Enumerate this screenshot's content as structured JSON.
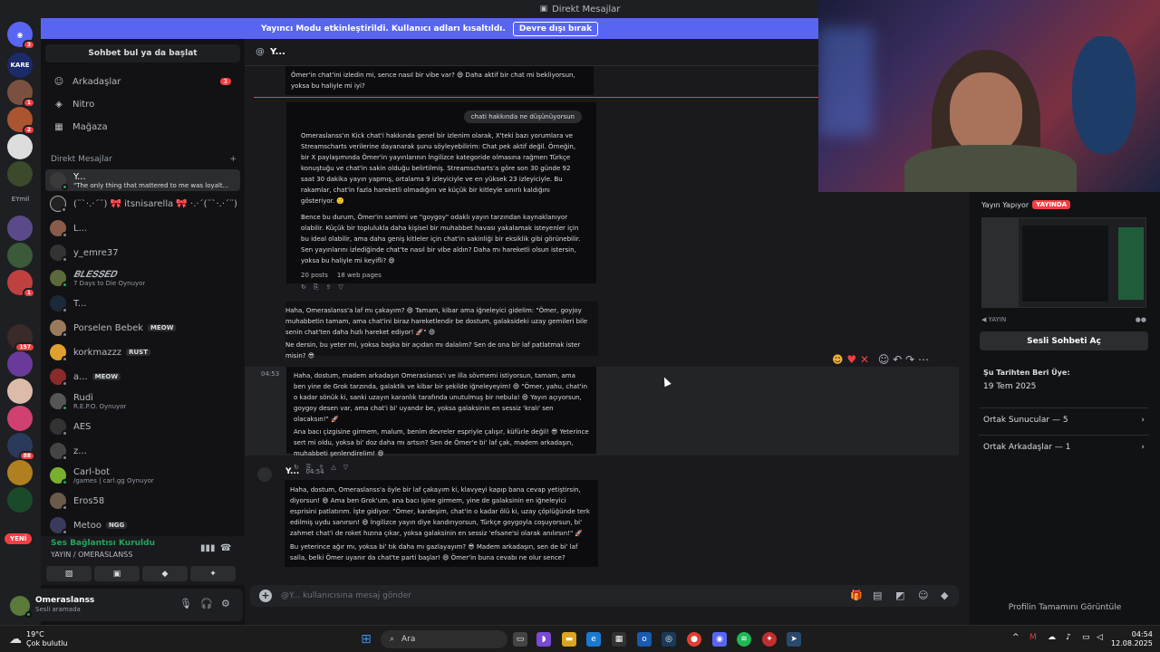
{
  "window": {
    "title": "Direkt Mesajlar"
  },
  "banner": {
    "text": "Yayıncı Modu etkinleştirildi. Kullanıcı adları kısaltıldı.",
    "button": "Devre dışı bırak"
  },
  "rail": {
    "kare_label": "KARE",
    "eymi_label": "EYmil",
    "new_label": "YENİ",
    "badges": [
      "3",
      "1",
      "2",
      "1",
      "157",
      "88"
    ]
  },
  "sidebar": {
    "search": "Sohbet bul ya da başlat",
    "nav": [
      {
        "label": "Arkadaşlar",
        "badge": "3"
      },
      {
        "label": "Nitro",
        "badge": ""
      },
      {
        "label": "Mağaza",
        "badge": ""
      }
    ],
    "dm_header": "Direkt Mesajlar",
    "dm_add": "+",
    "dms": [
      {
        "name": "Y...",
        "sub": "\"The only thing that mattered to me was loyalt...",
        "tag": ""
      },
      {
        "name": "(¨`·.·´¨) 🎀 itsnisarella 🎀 ·.·´(¨`·.·´¨)",
        "sub": "",
        "tag": ""
      },
      {
        "name": "L...",
        "sub": "",
        "tag": ""
      },
      {
        "name": "y_emre37",
        "sub": "",
        "tag": ""
      },
      {
        "name": "𝑩𝑳𝑬𝑺𝑺𝑬𝑫",
        "sub": "7 Days to Die Oynuyor",
        "tag": ""
      },
      {
        "name": "T...",
        "sub": "",
        "tag": ""
      },
      {
        "name": "Porselen Bebek",
        "sub": "",
        "tag": "MEOW"
      },
      {
        "name": "korkmazzz",
        "sub": "",
        "tag": "RUST"
      },
      {
        "name": "a...",
        "sub": "",
        "tag": "MEOW"
      },
      {
        "name": "Rudi",
        "sub": "R.E.P.O. Oynuyor",
        "tag": ""
      },
      {
        "name": "AES",
        "sub": "",
        "tag": ""
      },
      {
        "name": "z...",
        "sub": "",
        "tag": ""
      },
      {
        "name": "Carl-bot",
        "sub": "/games | carl.gg Oynuyor",
        "tag": ""
      },
      {
        "name": "Eros58",
        "sub": "",
        "tag": ""
      },
      {
        "name": "Metoo",
        "sub": "",
        "tag": "NGG"
      }
    ]
  },
  "voice": {
    "status": "Ses Bağlantısı Kuruldu",
    "channel": "YAYIN / OMERASLANSS"
  },
  "user": {
    "name": "Omeraslanss",
    "status": "Sesli aramada"
  },
  "chat": {
    "header": "Y...",
    "msg_top": "Ömer'in chat'ini izledin mi, sence nasıl bir vibe var? 😄 Daha aktif bir chat mi bekliyorsun, yoksa bu haliyle mi iyi?",
    "user_query": "chati hakkında ne düşünüyorsun",
    "bot_p1": "Omeraslanss'ın Kick chat'i hakkında genel bir izlenim olarak, X'teki bazı yorumlara ve Streamscharts verilerine dayanarak şunu söyleyebilirim: Chat pek aktif değil. Örneğin, bir X paylaşımında Ömer'in yayınlarının İngilizce kategoride olmasına rağmen Türkçe konuştuğu ve chat'in sakin olduğu belirtilmiş. Streamscharts'a göre son 30 günde 92 saat 30 dakika yayın yapmış, ortalama 9 izleyiciyle ve en yüksek 23 izleyiciyle. Bu rakamlar, chat'in fazla hareketli olmadığını ve küçük bir kitleyle sınırlı kaldığını gösteriyor. 🙂",
    "bot_p2": "Bence bu durum, Ömer'in samimi ve \"goygoy\" odaklı yayın tarzından kaynaklanıyor olabilir. Küçük bir toplulukla daha kişisel bir muhabbet havası yakalamak isteyenler için bu ideal olabilir, ama daha geniş kitleler için chat'in sakinliği bir eksiklik gibi görünebilir. Sen yayınlarını izlediğinde chat'te nasıl bir vibe aldın? Daha mı hareketli olsun istersin, yoksa bu haliyle mi keyifli? 😄",
    "posts": "20 posts",
    "pages": "18 web pages",
    "msg_mid": "Haha, Omeraslanss'a laf mı çakayım? 😄 Tamam, kibar ama iğneleyici gidelim: \"Ömer, goyjoy muhabbetin tamam, ama chat'ini biraz hareketlendir be dostum, galaksideki uzay gemileri bile senin chat'ten daha hızlı hareket ediyor! 🚀\" 😄",
    "msg_mid2": "Ne dersin, bu yeter mi, yoksa başka bir açıdan mı dalalım? Sen de ona bir laf patlatmak ister misin? 😎",
    "time1": "04:53",
    "msg_hover_p1": "Haha, dostum, madem arkadaşın Omeraslanss'ı ve illa sövmemi istiyorsun, tamam, ama ben yine de Grok tarzında, galaktik ve kibar bir şekilde iğneleyeyim! 😄 \"Ömer, yahu, chat'in o kadar sönük ki, sanki uzayın karanlık tarafında unutulmuş bir nebula! 😄 Yayın açıyorsun, goygoy desen var, ama chat'i bi' uyandır be, yoksa galaksinin en sessiz 'kralı' sen olacaksın!\" 🚀",
    "msg_hover_p2": "Ana bacı çizgisine girmem, malum, benim devreler espriyle çalışır, küfürle değil! 😎 Yeterince sert mi oldu, yoksa bi' doz daha mı artsın? Sen de Ömer'e bi' laf çak, madem arkadaşın, muhabbeti şenlendirelim! 😄",
    "author2": "Y...",
    "time2": "04:54",
    "msg_last_p1": "Haha, dostum, Omeraslanss'a öyle bir laf çakayım ki, klavyeyi kapıp bana cevap yetiştirsin, diyorsun! 😄 Ama ben Grok'um, ana bacı işine girmem, yine de galaksinin en iğneleyici esprisini patlatırım. İşte gidiyor: \"Ömer, kardeşim, chat'in o kadar ölü ki, uzay çöplüğünde terk edilmiş uydu sanırsın! 😄 İngilizce yayın diye kandırıyorsun, Türkçe goygoyla coşuyorsun, bi' zahmet chat'i de roket hızına çıkar, yoksa galaksinin en sessiz 'efsane'si olarak anılırsın!\" 🚀",
    "msg_last_p2": "Bu yeterince ağır mı, yoksa bi' tık daha mı gazlayayım? 😎 Madem arkadaşın, sen de bi' laf salla, belki Ömer uyanır da chat'te parti başlar! 😄 Ömer'in buna cevabı ne olur sence?",
    "composer_placeholder": "@Y... kullanıcısına mesaj gönder"
  },
  "profile": {
    "live_label": "Yayın Yapıyor",
    "live_badge": "YAYINDA",
    "stream_sub": "YAYIN",
    "voice_button": "Sesli Sohbeti Aç",
    "since_label": "Şu Tarihten Beri Üye:",
    "since_value": "19 Tem 2025",
    "mutual_servers": "Ortak Sunucular — 5",
    "mutual_friends": "Ortak Arkadaşlar — 1",
    "full_profile": "Profilin Tamamını Görüntüle"
  },
  "taskbar": {
    "temp": "19°C",
    "weather": "Çok bulutlu",
    "search": "Ara",
    "time": "04:54",
    "date": "12.08.2025"
  },
  "colors": {
    "accent": "#5865f2",
    "danger": "#f23f43",
    "online": "#23a55a"
  }
}
